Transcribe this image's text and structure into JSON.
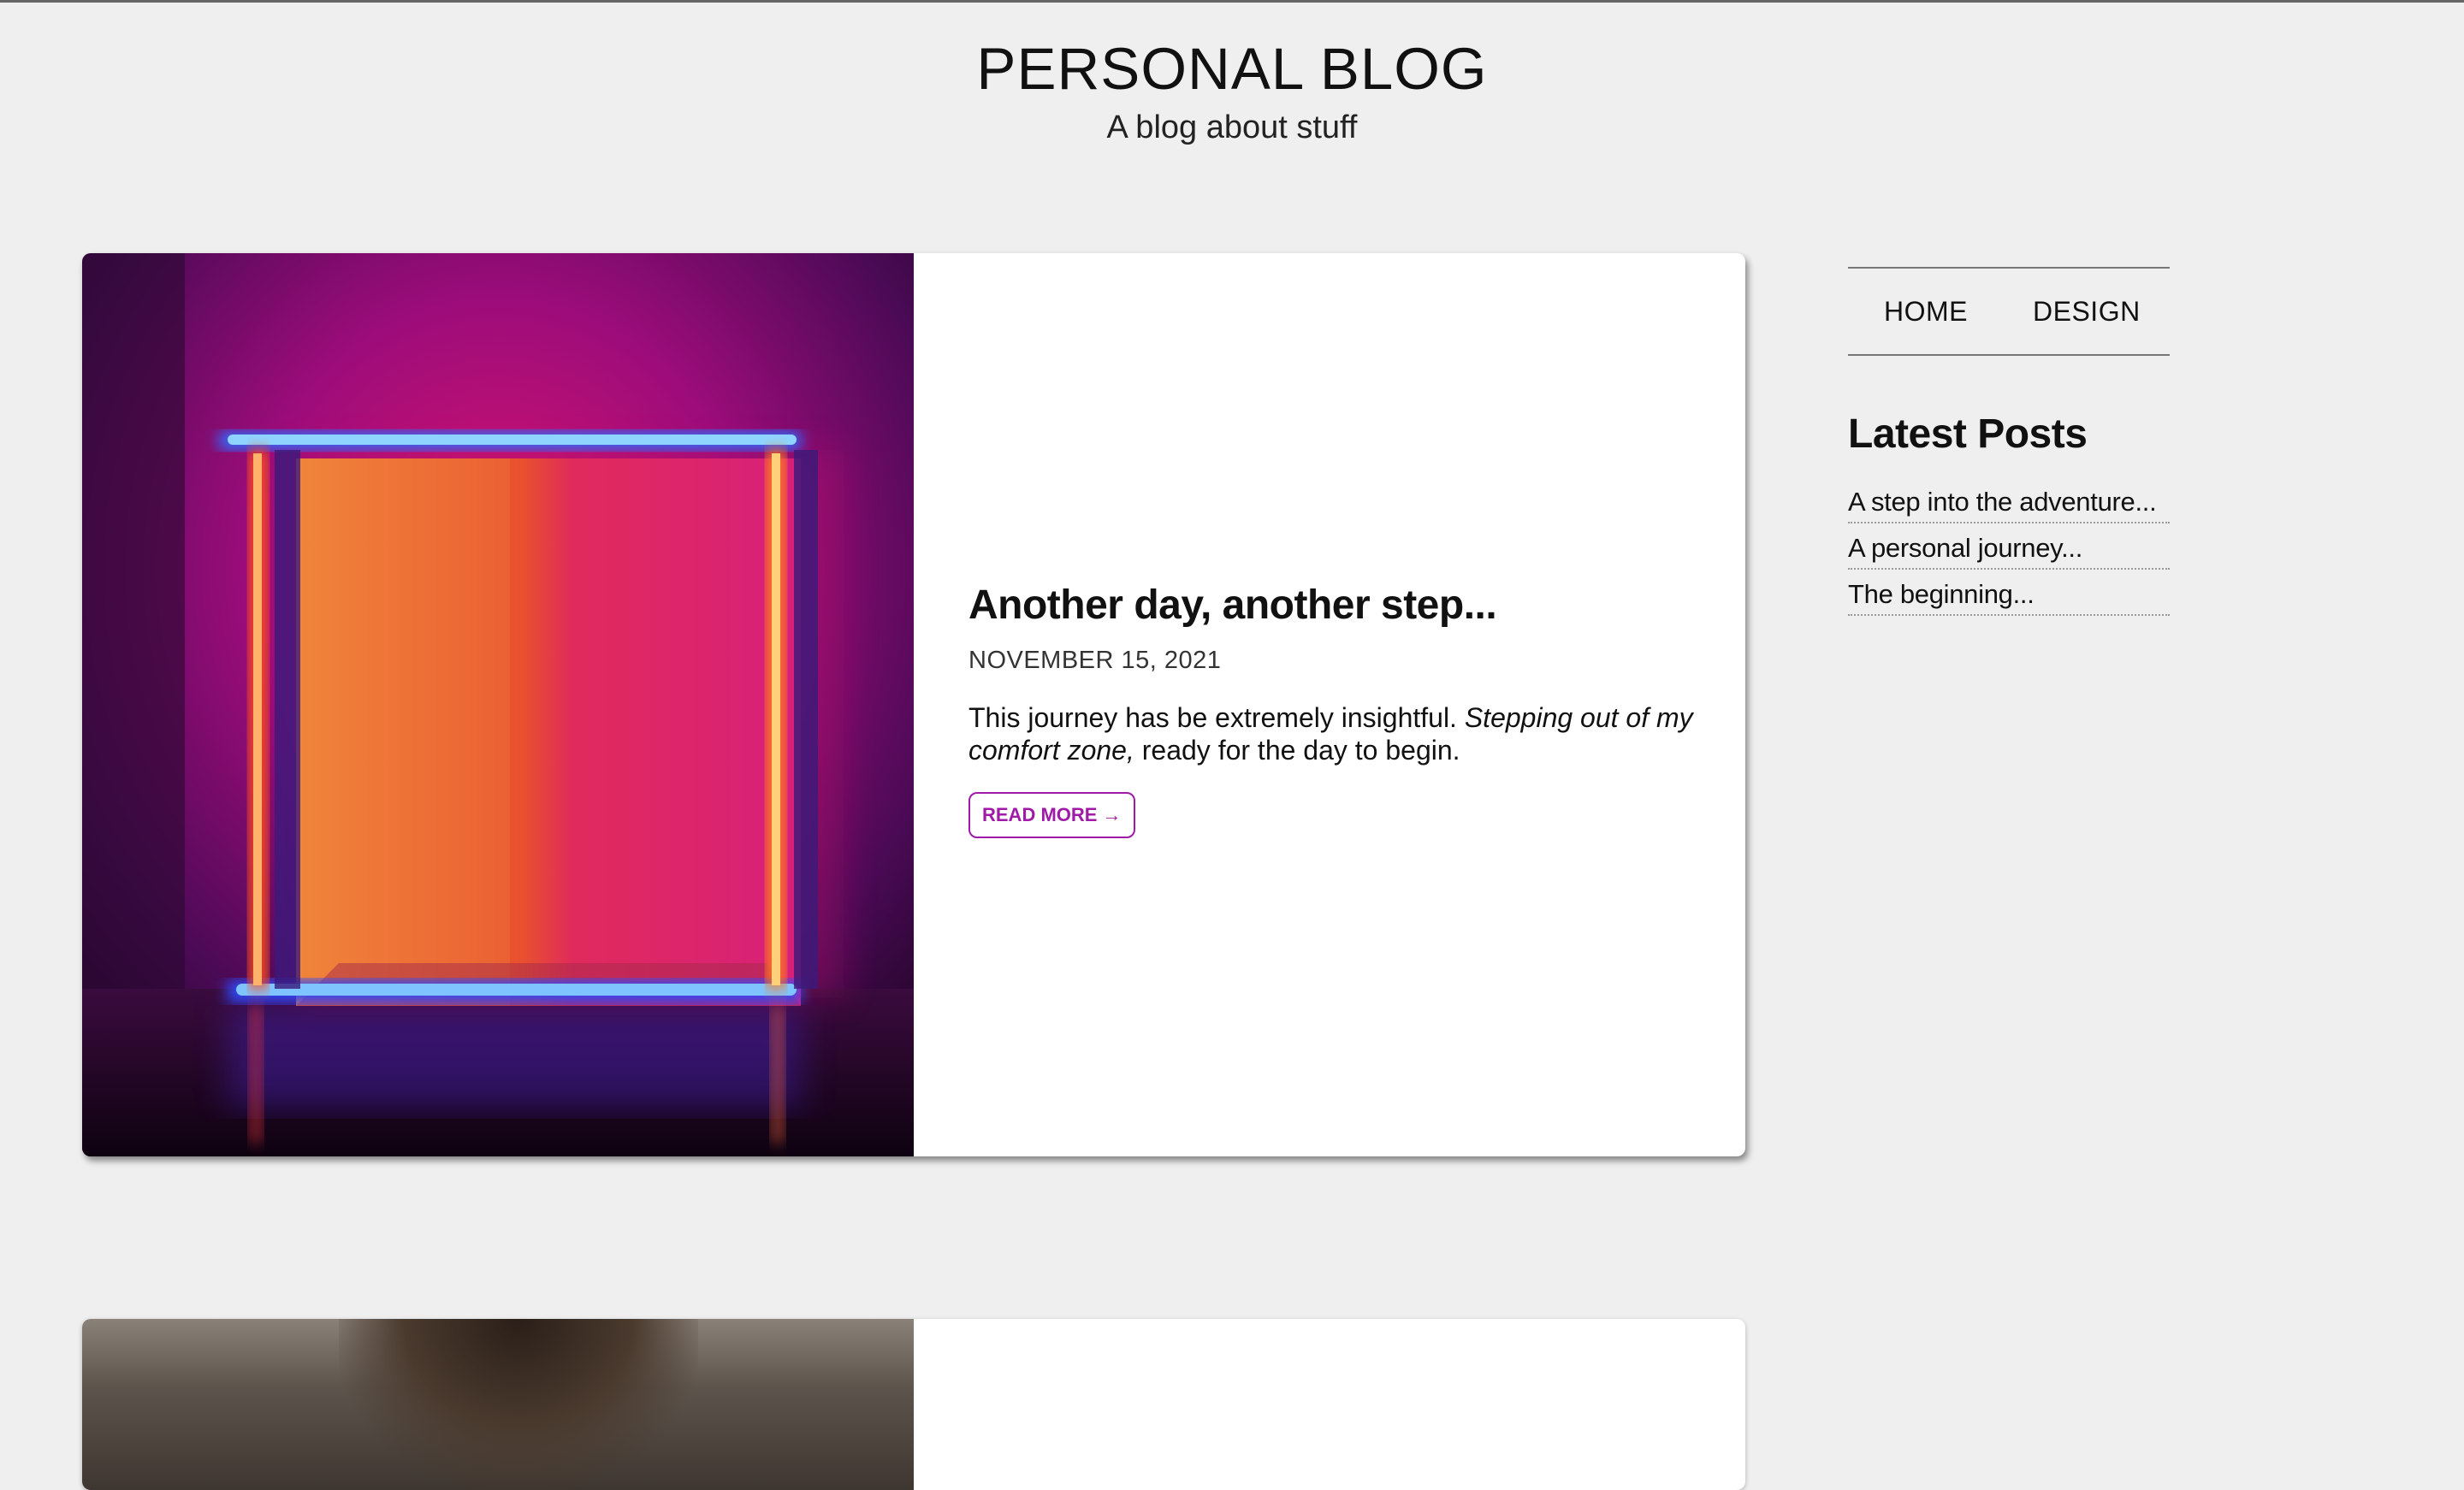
{
  "header": {
    "title": "PERSONAL BLOG",
    "tagline": "A blog about stuff"
  },
  "post": {
    "title": "Another day, another step...",
    "date": "NOVEMBER 15, 2021",
    "excerpt_plain": "This journey has be extremely insightful. ",
    "excerpt_italic": "Stepping out of my comfort zone,",
    "excerpt_end": " ready for the day to begin.",
    "read_more": "READ MORE →",
    "accent_color": "#a01aa8"
  },
  "sidebar": {
    "nav": [
      {
        "label": "HOME"
      },
      {
        "label": "DESIGN"
      }
    ],
    "latest_heading": "Latest Posts",
    "latest_posts": [
      {
        "title": "A step into the adventure..."
      },
      {
        "title": "A personal journey..."
      },
      {
        "title": "The beginning..."
      }
    ]
  }
}
